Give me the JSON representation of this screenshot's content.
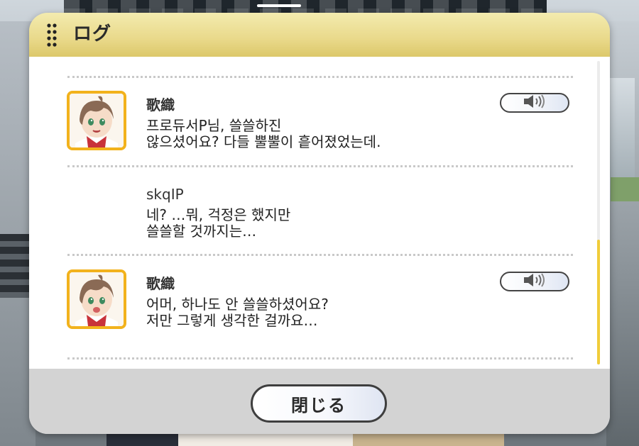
{
  "dialog": {
    "title": "ログ",
    "close_label": "閉じる"
  },
  "icons": {
    "grip": "grip-dots-icon",
    "voice": "speaker-icon",
    "avatar": "character-portrait"
  },
  "colors": {
    "header_yellow": "#e9d98a",
    "avatar_border": "#f2b21c",
    "scroll_thumb": "#f0cc3a"
  },
  "entries": [
    {
      "speaker": "歌織",
      "lines": [
        "프로듀서P님, 쓸쓸하진",
        "않으셨어요? 다들 뿔뿔이 흩어졌었는데."
      ],
      "has_avatar": true,
      "has_voice": true
    },
    {
      "speaker": "skqIP",
      "lines": [
        "네? …뭐, 걱정은 했지만",
        "쓸쓸할 것까지는…"
      ],
      "has_avatar": false,
      "has_voice": false
    },
    {
      "speaker": "歌織",
      "lines": [
        "어머, 하나도 안 쓸쓸하셨어요?",
        "저만 그렇게 생각한 걸까요…"
      ],
      "has_avatar": true,
      "has_voice": true
    }
  ]
}
